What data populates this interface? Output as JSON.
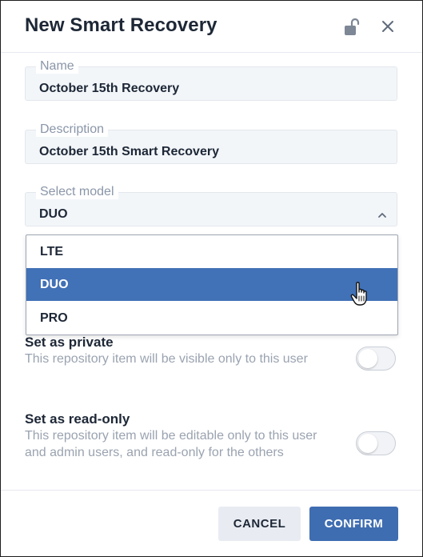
{
  "dialog": {
    "title": "New Smart Recovery"
  },
  "icons": {
    "lock": "unlocked-padlock-icon",
    "close": "close-icon",
    "chevron": "chevron-up-icon",
    "cursor": "hand-pointer-icon"
  },
  "fields": {
    "name": {
      "label": "Name",
      "value": "October 15th Recovery"
    },
    "description": {
      "label": "Description",
      "value": "October 15th Smart Recovery"
    },
    "model": {
      "label": "Select model",
      "value": "DUO",
      "options": [
        "LTE",
        "DUO",
        "PRO"
      ],
      "selected": "DUO"
    }
  },
  "toggles": {
    "private": {
      "title": "Set as private",
      "description": "This repository item will be visible only to this user",
      "on": false
    },
    "readonly": {
      "title": "Set as read-only",
      "description": "This repository item will be editable only to this user and admin users, and read-only for the others",
      "on": false
    }
  },
  "footer": {
    "cancel_label": "CANCEL",
    "confirm_label": "CONFIRM"
  },
  "colors": {
    "accent": "#3f6db1",
    "selected_option": "#4171b6",
    "text_primary": "#1d2736",
    "text_muted": "#9aa3b0"
  }
}
